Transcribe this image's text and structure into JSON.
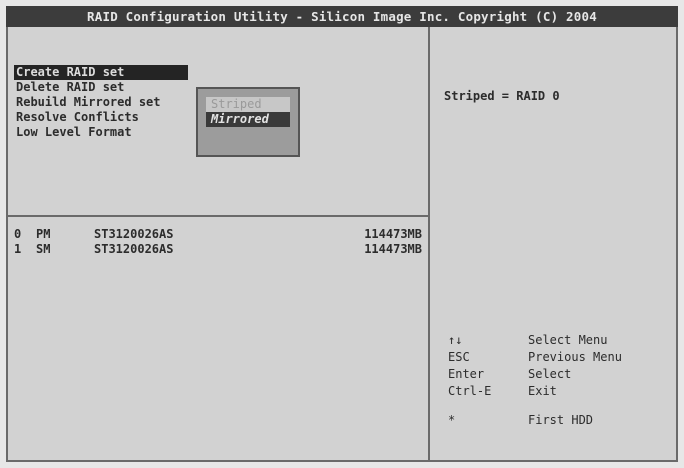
{
  "title": "RAID Configuration Utility - Silicon Image Inc. Copyright (C) 2004",
  "menu": [
    "Create RAID set",
    "Delete RAID set",
    "Rebuild Mirrored set",
    "Resolve Conflicts",
    "Low Level Format"
  ],
  "popup": {
    "options": [
      "Striped",
      "Mirrored"
    ],
    "selected": "Mirrored"
  },
  "drives": [
    {
      "index": "0",
      "role": "PM",
      "model": "ST3120026AS",
      "size": "114473MB"
    },
    {
      "index": "1",
      "role": "SM",
      "model": "ST3120026AS",
      "size": "114473MB"
    }
  ],
  "info": "Striped = RAID 0",
  "keys": [
    {
      "key": "↑↓",
      "action": "Select Menu"
    },
    {
      "key": "ESC",
      "action": "Previous Menu"
    },
    {
      "key": "Enter",
      "action": "Select"
    },
    {
      "key": "Ctrl-E",
      "action": "Exit"
    },
    {
      "key": "*",
      "action": "First HDD"
    }
  ],
  "colors": {
    "background": "#dcdcdc",
    "highlight": "#242424",
    "title_bar": "#3c3c3c"
  }
}
